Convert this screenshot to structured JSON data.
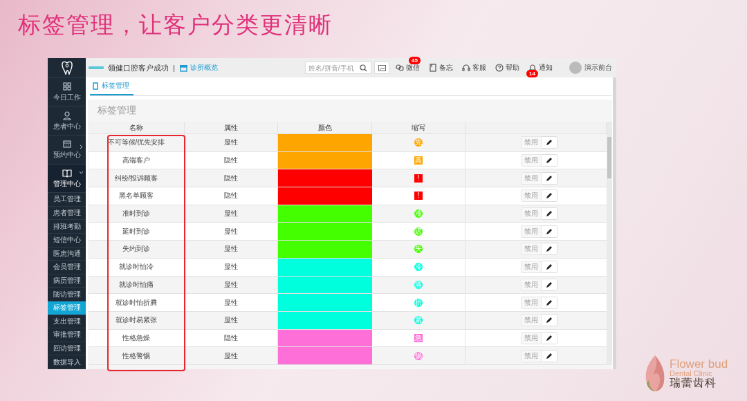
{
  "slide": {
    "title": "标签管理，让客户分类更清晰"
  },
  "topbar": {
    "brand": "领健口腔客户成功",
    "separator": "|",
    "overview_link": "诊所概览",
    "search": {
      "placeholder": "姓名/拼音/手机"
    },
    "tools": [
      {
        "label": "微信",
        "badge": "45"
      },
      {
        "label": "备忘"
      },
      {
        "label": "客服"
      },
      {
        "label": "帮助"
      },
      {
        "label": "通知",
        "badge": "14"
      }
    ],
    "user": "演示前台"
  },
  "sidebar": {
    "sections": [
      {
        "label": "今日工作",
        "kind": "link"
      },
      {
        "label": "患者中心",
        "kind": "link"
      },
      {
        "label": "预约中心",
        "kind": "group",
        "expanded": false
      },
      {
        "label": "管理中心",
        "kind": "group",
        "expanded": true
      }
    ],
    "items": [
      {
        "label": "员工管理",
        "selected": false
      },
      {
        "label": "患者管理",
        "selected": false
      },
      {
        "label": "排班考勤",
        "selected": false
      },
      {
        "label": "短信中心",
        "selected": false
      },
      {
        "label": "医患沟通",
        "selected": false
      },
      {
        "label": "会员管理",
        "selected": false
      },
      {
        "label": "病历管理",
        "selected": false
      },
      {
        "label": "随访管理",
        "selected": false
      },
      {
        "label": "标签管理",
        "selected": true
      },
      {
        "label": "支出管理",
        "selected": false
      },
      {
        "label": "审批管理",
        "selected": false
      },
      {
        "label": "回访管理",
        "selected": false
      },
      {
        "label": "数据导入",
        "selected": false
      }
    ]
  },
  "tabs": [
    {
      "label": "标签管理",
      "selected": true
    }
  ],
  "panel": {
    "title": "标签管理",
    "table": {
      "columns": [
        "名称",
        "属性",
        "颜色",
        "缩写"
      ],
      "rows": [
        {
          "name": "不可等候/优先安排",
          "attribute": "显性",
          "color": "#ffa500",
          "abbr": "先",
          "kind": "circle",
          "action": "禁用"
        },
        {
          "name": "高端客户",
          "attribute": "隐性",
          "color": "#ffa500",
          "abbr": "高",
          "kind": "square",
          "action": "禁用"
        },
        {
          "name": "纠纷/投诉顾客",
          "attribute": "隐性",
          "color": "#ff0000",
          "abbr": "!",
          "kind": "square",
          "action": "禁用"
        },
        {
          "name": "黑名单顾客",
          "attribute": "隐性",
          "color": "#ff0000",
          "abbr": "!",
          "kind": "square",
          "action": "禁用"
        },
        {
          "name": "准时到诊",
          "attribute": "显性",
          "color": "#44ff00",
          "abbr": "准",
          "kind": "circle",
          "action": "禁用"
        },
        {
          "name": "延时到诊",
          "attribute": "显性",
          "color": "#44ff00",
          "abbr": "迟",
          "kind": "circle",
          "action": "禁用"
        },
        {
          "name": "失约到诊",
          "attribute": "显性",
          "color": "#44ff00",
          "abbr": "失",
          "kind": "circle",
          "action": "禁用"
        },
        {
          "name": "就诊时怕冷",
          "attribute": "显性",
          "color": "#00ffdd",
          "abbr": "冷",
          "kind": "circle",
          "action": "禁用"
        },
        {
          "name": "就诊时怕痛",
          "attribute": "显性",
          "color": "#00ffdd",
          "abbr": "痛",
          "kind": "circle",
          "action": "禁用"
        },
        {
          "name": "就诊时怕折腾",
          "attribute": "显性",
          "color": "#00ffdd",
          "abbr": "折",
          "kind": "circle",
          "action": "禁用"
        },
        {
          "name": "就诊时易紧张",
          "attribute": "显性",
          "color": "#00ffdd",
          "abbr": "紧",
          "kind": "circle",
          "action": "禁用"
        },
        {
          "name": "性格急燥",
          "attribute": "隐性",
          "color": "#ff6fd8",
          "abbr": "急",
          "kind": "square",
          "action": "禁用"
        },
        {
          "name": "性格警惕",
          "attribute": "显性",
          "color": "#ff6fd8",
          "abbr": "惕",
          "kind": "circle",
          "action": "禁用"
        }
      ]
    }
  },
  "logo": {
    "name": "Flower bud",
    "subtitle": "Dental Clinic",
    "chinese_name": "瑞蕾齿科"
  }
}
